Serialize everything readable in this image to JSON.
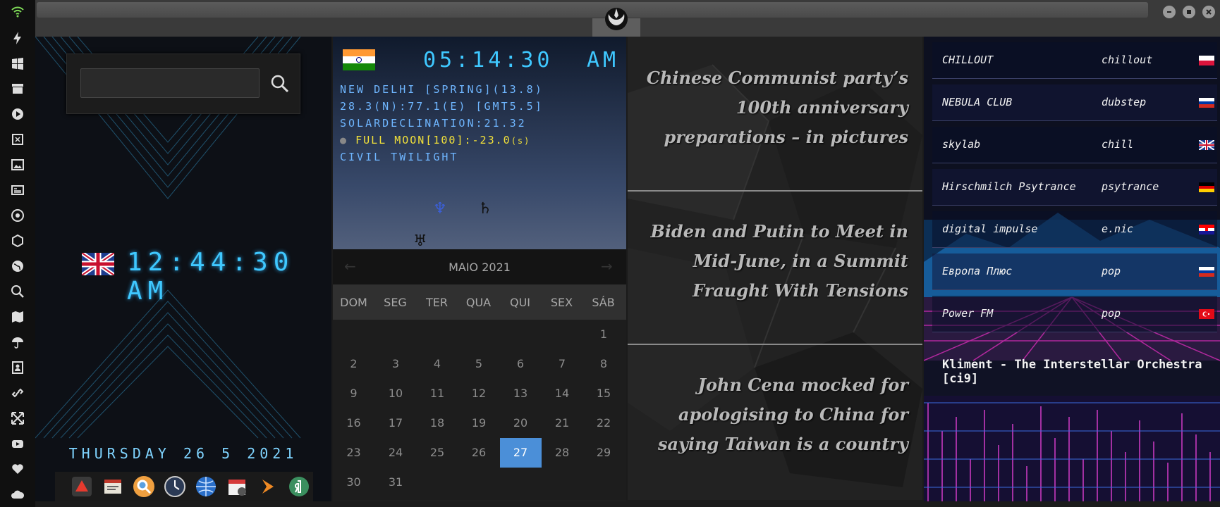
{
  "sidebar": {
    "icons": [
      "wifi-icon",
      "bolt-icon",
      "windows-icon",
      "archive-icon",
      "play-icon",
      "map-book-icon",
      "image-icon",
      "newspaper-icon",
      "atom-icon",
      "hexagon-icon",
      "globe-icon",
      "search-icon",
      "map-icon",
      "umbrella-icon",
      "contacts-icon",
      "link-icon",
      "fullscreen-icon",
      "youtube-icon",
      "heart-icon",
      "cloud-icon"
    ],
    "accent": "#7ed957"
  },
  "clock": {
    "search_value": "",
    "time": "12:44:30 AM",
    "date": "THURSDAY 26 5 2021",
    "flag": "uk-flag",
    "dock_icons": [
      "anydesk-icon",
      "notes-icon",
      "search-app-icon",
      "clock-app-icon",
      "browser-globe-icon",
      "calendar-app-icon",
      "sublime-icon",
      "yandex-icon"
    ],
    "accent": "#3fc8ff"
  },
  "astro": {
    "flag": "india-flag",
    "time": "05:14:30",
    "ampm": "AM",
    "location": "NEW DELHI [SPRING](13.8)",
    "coords": "28.3(N):77.1(E) [GMT5.5]",
    "declination": "SOLARDECLINATION:21.32",
    "moon": "FULL MOON[100]:-23.0",
    "moon_suffix": "(s)",
    "twilight": "CIVIL TWILIGHT",
    "planets": [
      "♆",
      "♄",
      "♅"
    ]
  },
  "calendar": {
    "month": "MAIO 2021",
    "weekdays": [
      "DOM",
      "SEG",
      "TER",
      "QUA",
      "QUI",
      "SEX",
      "SÁB"
    ],
    "first_weekday": 6,
    "days": 31,
    "selected": 27,
    "selected_color": "#4b8fd8"
  },
  "news": {
    "items": [
      "Chinese Communist party’s 100th anniversary preparations – in pictures",
      "Biden and Putin to Meet in Mid-June, in a Summit Fraught With Tensions",
      "John Cena mocked for apologising to China for saying Taiwan is a country"
    ]
  },
  "radio": {
    "stations": [
      {
        "name": "CHILLOUT",
        "genre": "chillout",
        "flag": "poland-flag"
      },
      {
        "name": "NEBULA CLUB",
        "genre": "dubstep",
        "flag": "russia-flag"
      },
      {
        "name": "skylab",
        "genre": "chill",
        "flag": "uk-flag"
      },
      {
        "name": "Hirschmilch Psytrance",
        "genre": "psytrance",
        "flag": "germany-flag"
      },
      {
        "name": "digital impulse",
        "genre": "e.nic",
        "flag": "croatia-flag"
      },
      {
        "name": "Европа Плюс",
        "genre": "pop",
        "flag": "russia-flag"
      },
      {
        "name": "Power FM",
        "genre": "pop",
        "flag": "turkey-flag"
      }
    ],
    "now_playing": "Kliment - The Interstellar Orchestra [ci9]"
  }
}
